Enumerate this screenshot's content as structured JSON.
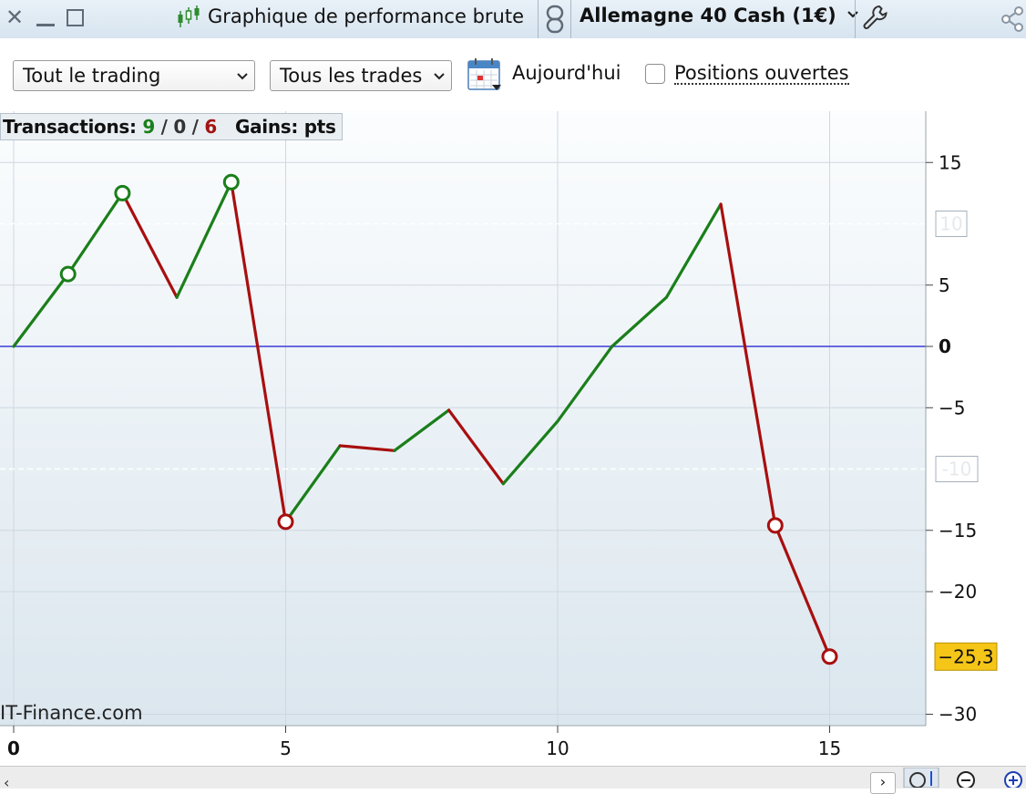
{
  "window": {
    "title": "Graphique de performance brute",
    "instrument": "Allemagne 40 Cash (1€)",
    "icons": [
      "close-icon",
      "minimize-icon",
      "maximize-icon",
      "candlestick-icon",
      "link-icon",
      "chevron-down-icon",
      "wrench-icon",
      "share-icon"
    ]
  },
  "toolbar": {
    "scope_select": "Tout le trading",
    "trades_select": "Tous les trades",
    "today_label": "Aujourd'hui",
    "open_positions_label": "Positions ouvertes",
    "open_positions_checked": false
  },
  "summary": {
    "transactions_label": "Transactions:",
    "wins": "9",
    "sep1": "/",
    "neutral": "0",
    "sep2": "/",
    "losses": "6",
    "gains_label": "Gains: pts"
  },
  "watermark": "IT-Finance.com",
  "colors": {
    "gain": "#1a7f1a",
    "loss": "#a80f0f",
    "zero_line": "#3b3bd6",
    "last_value_badge": "#f5c518"
  },
  "chart_data": {
    "type": "line",
    "x": [
      0,
      1,
      2,
      3,
      4,
      5,
      6,
      7,
      8,
      9,
      10,
      11,
      12,
      13,
      14,
      15
    ],
    "y": [
      0,
      5.9,
      12.5,
      4,
      13.4,
      -14.3,
      -8.1,
      -8.5,
      -5.2,
      -11.2,
      -6.1,
      0,
      4,
      11.6,
      -14.6,
      -25.3
    ],
    "segment_colors": [
      "gain",
      "gain",
      "loss",
      "gain",
      "loss",
      "gain",
      "loss",
      "gain",
      "loss",
      "gain",
      "gain",
      "gain",
      "gain",
      "loss",
      "loss"
    ],
    "markers": [
      {
        "x": 1,
        "y": 5.9,
        "color": "gain"
      },
      {
        "x": 2,
        "y": 12.5,
        "color": "gain"
      },
      {
        "x": 4,
        "y": 13.4,
        "color": "gain"
      },
      {
        "x": 5,
        "y": -14.3,
        "color": "loss"
      },
      {
        "x": 14,
        "y": -14.6,
        "color": "loss"
      },
      {
        "x": 15,
        "y": -25.3,
        "color": "loss"
      }
    ],
    "xlim": [
      0,
      17
    ],
    "ylim": [
      -31,
      19
    ],
    "x_ticks": [
      0,
      5,
      10,
      15
    ],
    "x_tick_labels": [
      "0",
      "5",
      "10",
      "15"
    ],
    "y_ticks": [
      15,
      5,
      0,
      -5,
      -15,
      -20,
      -30
    ],
    "y_tick_labels": [
      "15",
      "5",
      "0",
      "-5",
      "-15",
      "-20",
      "-30"
    ],
    "dashed_levels": [
      10,
      -10
    ],
    "dashed_level_labels": [
      "10",
      "-10"
    ],
    "zero_line": 0,
    "last_value": -25.3,
    "last_value_label": "-25,3",
    "grid": true
  }
}
